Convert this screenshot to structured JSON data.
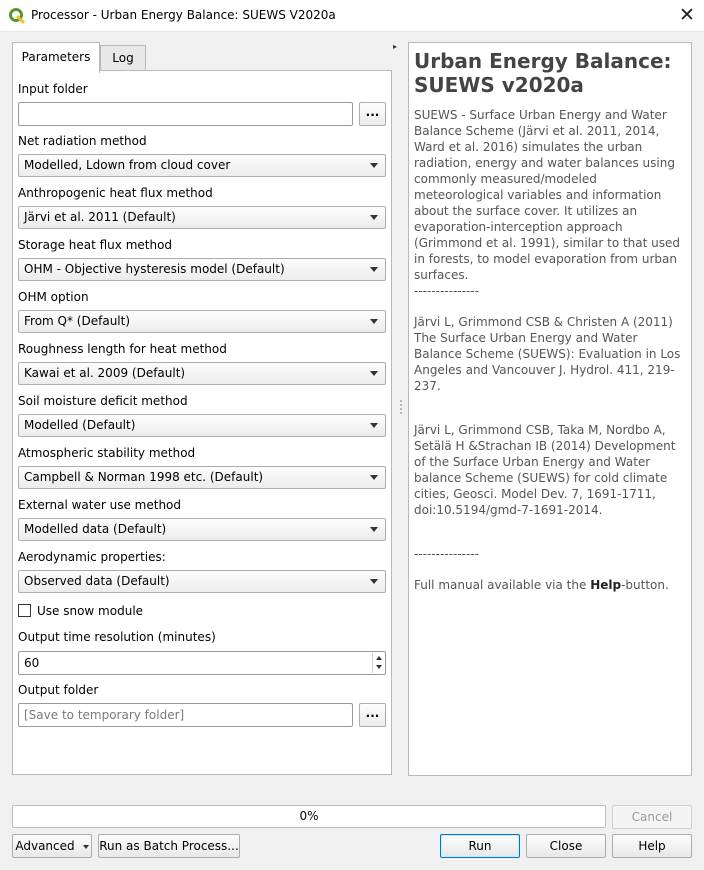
{
  "window": {
    "title": "Processor - Urban Energy Balance: SUEWS V2020a",
    "app_icon": "qgis-icon",
    "close_glyph": "✕"
  },
  "tabs": [
    {
      "label": "Parameters",
      "active": true
    },
    {
      "label": "Log",
      "active": false
    }
  ],
  "params": {
    "input_folder": {
      "label": "Input folder",
      "value": "",
      "browse": "..."
    },
    "net_radiation": {
      "label": "Net radiation method",
      "value": "Modelled, Ldown from cloud cover"
    },
    "anthropogenic": {
      "label": "Anthropogenic heat flux method",
      "value": "Järvi et al. 2011 (Default)"
    },
    "storage": {
      "label": "Storage heat flux method",
      "value": "OHM - Objective hysteresis model (Default)"
    },
    "ohm": {
      "label": "OHM option",
      "value": "From Q* (Default)"
    },
    "roughness": {
      "label": "Roughness length for heat method",
      "value": "Kawai et al. 2009 (Default)"
    },
    "soil": {
      "label": "Soil moisture deficit method",
      "value": "Modelled (Default)"
    },
    "stability": {
      "label": "Atmospheric stability method",
      "value": "Campbell & Norman 1998 etc. (Default)"
    },
    "water_use": {
      "label": "External water use method",
      "value": "Modelled data (Default)"
    },
    "aero": {
      "label": "Aerodynamic properties:",
      "value": "Observed data (Default)"
    },
    "snow": {
      "label": "Use snow module",
      "checked": false
    },
    "time_res": {
      "label": "Output time resolution (minutes)",
      "value": "60"
    },
    "output_folder": {
      "label": "Output folder",
      "placeholder": "[Save to temporary folder]",
      "browse": "..."
    }
  },
  "help": {
    "title": "Urban Energy Balance: SUEWS v2020a",
    "p1": "SUEWS - Surface Urban Energy and Water Balance Scheme (Järvi et al. 2011, 2014, Ward et al. 2016) simulates the urban radiation, energy and water balances using commonly measured/modeled meteorological variables and information about the surface cover. It utilizes an evaporation-interception approach (Grimmond et al. 1991), similar to that used in forests, to model evaporation from urban surfaces.",
    "sep": "---------------",
    "ref1": "Järvi L, Grimmond CSB & Christen A (2011) The Surface Urban Energy and Water Balance Scheme (SUEWS): Evaluation in Los Angeles and Vancouver J. Hydrol. 411, 219-237.",
    "ref2": "Järvi L, Grimmond CSB, Taka M, Nordbo A, Setälä H &Strachan IB (2014) Development of the Surface Urban Energy and Water balance Scheme (SUEWS) for cold climate cities, Geosci. Model Dev. 7, 1691-1711, doi:10.5194/gmd-7-1691-2014.",
    "manual_pre": "Full manual available via the ",
    "manual_bold": "Help",
    "manual_post": "-button."
  },
  "progress": {
    "text": "0%",
    "value": 0
  },
  "buttons": {
    "cancel": "Cancel",
    "advanced": "Advanced",
    "batch": "Run as Batch Process...",
    "run": "Run",
    "close": "Close",
    "help": "Help"
  },
  "colors": {
    "accent": "#0078d7",
    "qgis_green": "#589632",
    "qgis_yellow": "#eebd28"
  }
}
